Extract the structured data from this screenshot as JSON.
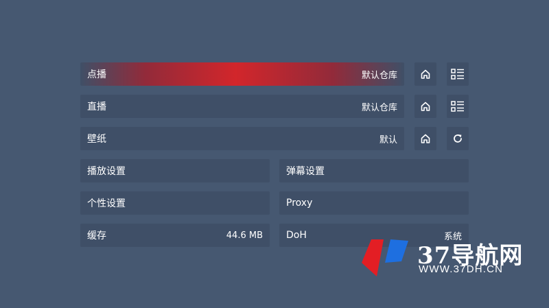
{
  "settings": {
    "vod": {
      "label": "点播",
      "value": "默认仓库"
    },
    "live": {
      "label": "直播",
      "value": "默认仓库"
    },
    "wallpaper": {
      "label": "壁纸",
      "value": "默认"
    },
    "player_settings": {
      "label": "播放设置"
    },
    "danmaku_settings": {
      "label": "弹幕设置"
    },
    "personal_settings": {
      "label": "个性设置"
    },
    "proxy": {
      "label": "Proxy"
    },
    "cache": {
      "label": "缓存",
      "value": "44.6 MB"
    },
    "doh": {
      "label": "DoH",
      "value": "系统"
    }
  },
  "icons": {
    "vod_home": "home-icon",
    "vod_list": "list-icon",
    "live_home": "home-icon",
    "live_list": "list-icon",
    "wallpaper_home": "home-icon",
    "wallpaper_refresh": "refresh-icon"
  },
  "watermark": {
    "title": "37导航网",
    "url": "WWW.37DH.CN"
  },
  "colors": {
    "background": "#465871",
    "focus_accent": "#d2262b",
    "logo_red": "#e31e24",
    "logo_blue": "#1e6fe0"
  }
}
